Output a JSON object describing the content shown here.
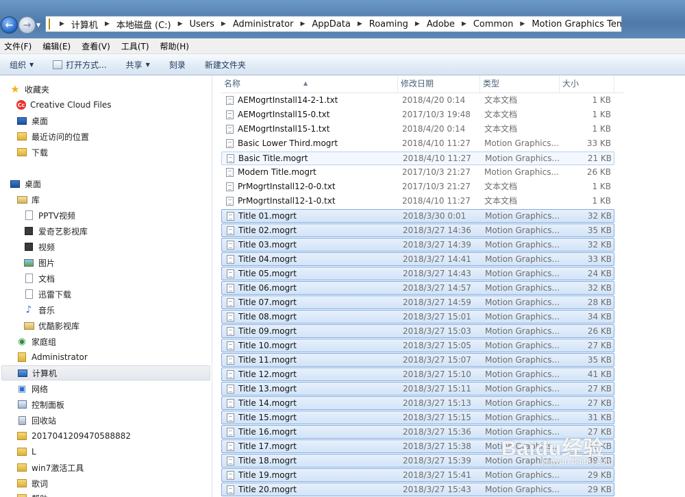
{
  "breadcrumb": [
    "计算机",
    "本地磁盘 (C:)",
    "Users",
    "Administrator",
    "AppData",
    "Roaming",
    "Adobe",
    "Common",
    "Motion Graphics Templates"
  ],
  "menu": [
    "文件(F)",
    "编辑(E)",
    "查看(V)",
    "工具(T)",
    "帮助(H)"
  ],
  "toolbar": {
    "organize": "组织",
    "open_with": "打开方式...",
    "share": "共享",
    "burn": "刻录",
    "new_folder": "新建文件夹"
  },
  "nav": [
    {
      "label": "收藏夹",
      "icon": "star-icon"
    },
    {
      "label": "Creative Cloud Files",
      "icon": "creative-cloud-icon"
    },
    {
      "label": "桌面",
      "icon": "desktop-icon"
    },
    {
      "label": "最近访问的位置",
      "icon": "recent-places-icon"
    },
    {
      "label": "下载",
      "icon": "download-folder-icon"
    },
    {
      "label": "桌面",
      "icon": "desktop-icon"
    },
    {
      "label": "库",
      "icon": "library-icon"
    },
    {
      "label": "PPTV视频",
      "icon": "library-video-icon"
    },
    {
      "label": "爱奇艺影视库",
      "icon": "library-video-icon"
    },
    {
      "label": "视频",
      "icon": "video-icon"
    },
    {
      "label": "图片",
      "icon": "pictures-icon"
    },
    {
      "label": "文档",
      "icon": "documents-icon"
    },
    {
      "label": "迅雷下载",
      "icon": "documents-icon"
    },
    {
      "label": "音乐",
      "icon": "music-icon"
    },
    {
      "label": "优酷影视库",
      "icon": "library-folder-icon"
    },
    {
      "label": "家庭组",
      "icon": "homegroup-icon"
    },
    {
      "label": "Administrator",
      "icon": "user-folder-icon"
    },
    {
      "label": "计算机",
      "icon": "computer-icon"
    },
    {
      "label": "网络",
      "icon": "network-icon"
    },
    {
      "label": "控制面板",
      "icon": "control-panel-icon"
    },
    {
      "label": "回收站",
      "icon": "recycle-bin-icon"
    },
    {
      "label": "2017041209470588882",
      "icon": "folder-icon"
    },
    {
      "label": "L",
      "icon": "folder-icon"
    },
    {
      "label": "win7激活工具",
      "icon": "folder-icon"
    },
    {
      "label": "歌词",
      "icon": "folder-icon"
    },
    {
      "label": "帮助",
      "icon": "folder-icon"
    }
  ],
  "columns": {
    "name": "名称",
    "date": "修改日期",
    "type": "类型",
    "size": "大小"
  },
  "files": [
    {
      "name": "AEMogrtInstall14-2-1.txt",
      "date": "2018/4/20 0:14",
      "type": "文本文档",
      "size": "1 KB"
    },
    {
      "name": "AEMogrtInstall15-0.txt",
      "date": "2017/10/3 19:48",
      "type": "文本文档",
      "size": "1 KB"
    },
    {
      "name": "AEMogrtInstall15-1.txt",
      "date": "2018/4/20 0:14",
      "type": "文本文档",
      "size": "1 KB"
    },
    {
      "name": "Basic Lower Third.mogrt",
      "date": "2018/4/10 11:27",
      "type": "Motion Graphics...",
      "size": "33 KB"
    },
    {
      "name": "Basic Title.mogrt",
      "date": "2018/4/10 11:27",
      "type": "Motion Graphics...",
      "size": "21 KB"
    },
    {
      "name": "Modern Title.mogrt",
      "date": "2017/10/3 21:27",
      "type": "Motion Graphics...",
      "size": "26 KB"
    },
    {
      "name": "PrMogrtInstall12-0-0.txt",
      "date": "2017/10/3 21:27",
      "type": "文本文档",
      "size": "1 KB"
    },
    {
      "name": "PrMogrtInstall12-1-0.txt",
      "date": "2018/4/10 11:27",
      "type": "文本文档",
      "size": "1 KB"
    },
    {
      "name": "Title 01.mogrt",
      "date": "2018/3/30 0:01",
      "type": "Motion Graphics...",
      "size": "32 KB"
    },
    {
      "name": "Title 02.mogrt",
      "date": "2018/3/27 14:36",
      "type": "Motion Graphics...",
      "size": "35 KB"
    },
    {
      "name": "Title 03.mogrt",
      "date": "2018/3/27 14:39",
      "type": "Motion Graphics...",
      "size": "32 KB"
    },
    {
      "name": "Title 04.mogrt",
      "date": "2018/3/27 14:41",
      "type": "Motion Graphics...",
      "size": "33 KB"
    },
    {
      "name": "Title 05.mogrt",
      "date": "2018/3/27 14:43",
      "type": "Motion Graphics...",
      "size": "24 KB"
    },
    {
      "name": "Title 06.mogrt",
      "date": "2018/3/27 14:57",
      "type": "Motion Graphics...",
      "size": "32 KB"
    },
    {
      "name": "Title 07.mogrt",
      "date": "2018/3/27 14:59",
      "type": "Motion Graphics...",
      "size": "28 KB"
    },
    {
      "name": "Title 08.mogrt",
      "date": "2018/3/27 15:01",
      "type": "Motion Graphics...",
      "size": "34 KB"
    },
    {
      "name": "Title 09.mogrt",
      "date": "2018/3/27 15:03",
      "type": "Motion Graphics...",
      "size": "26 KB"
    },
    {
      "name": "Title 10.mogrt",
      "date": "2018/3/27 15:05",
      "type": "Motion Graphics...",
      "size": "27 KB"
    },
    {
      "name": "Title 11.mogrt",
      "date": "2018/3/27 15:07",
      "type": "Motion Graphics...",
      "size": "35 KB"
    },
    {
      "name": "Title 12.mogrt",
      "date": "2018/3/27 15:10",
      "type": "Motion Graphics...",
      "size": "41 KB"
    },
    {
      "name": "Title 13.mogrt",
      "date": "2018/3/27 15:11",
      "type": "Motion Graphics...",
      "size": "27 KB"
    },
    {
      "name": "Title 14.mogrt",
      "date": "2018/3/27 15:13",
      "type": "Motion Graphics...",
      "size": "27 KB"
    },
    {
      "name": "Title 15.mogrt",
      "date": "2018/3/27 15:15",
      "type": "Motion Graphics...",
      "size": "31 KB"
    },
    {
      "name": "Title 16.mogrt",
      "date": "2018/3/27 15:36",
      "type": "Motion Graphics...",
      "size": "27 KB"
    },
    {
      "name": "Title 17.mogrt",
      "date": "2018/3/27 15:38",
      "type": "Motion Graphics...",
      "size": "33 KB"
    },
    {
      "name": "Title 18.mogrt",
      "date": "2018/3/27 15:39",
      "type": "Motion Graphics...",
      "size": "39 KB"
    },
    {
      "name": "Title 19.mogrt",
      "date": "2018/3/27 15:41",
      "type": "Motion Graphics...",
      "size": "29 KB"
    },
    {
      "name": "Title 20.mogrt",
      "date": "2018/3/27 15:43",
      "type": "Motion Graphics...",
      "size": "29 KB"
    }
  ],
  "watermark": {
    "main": "Baidu经验",
    "sub": "jingyan.baidu.com"
  }
}
